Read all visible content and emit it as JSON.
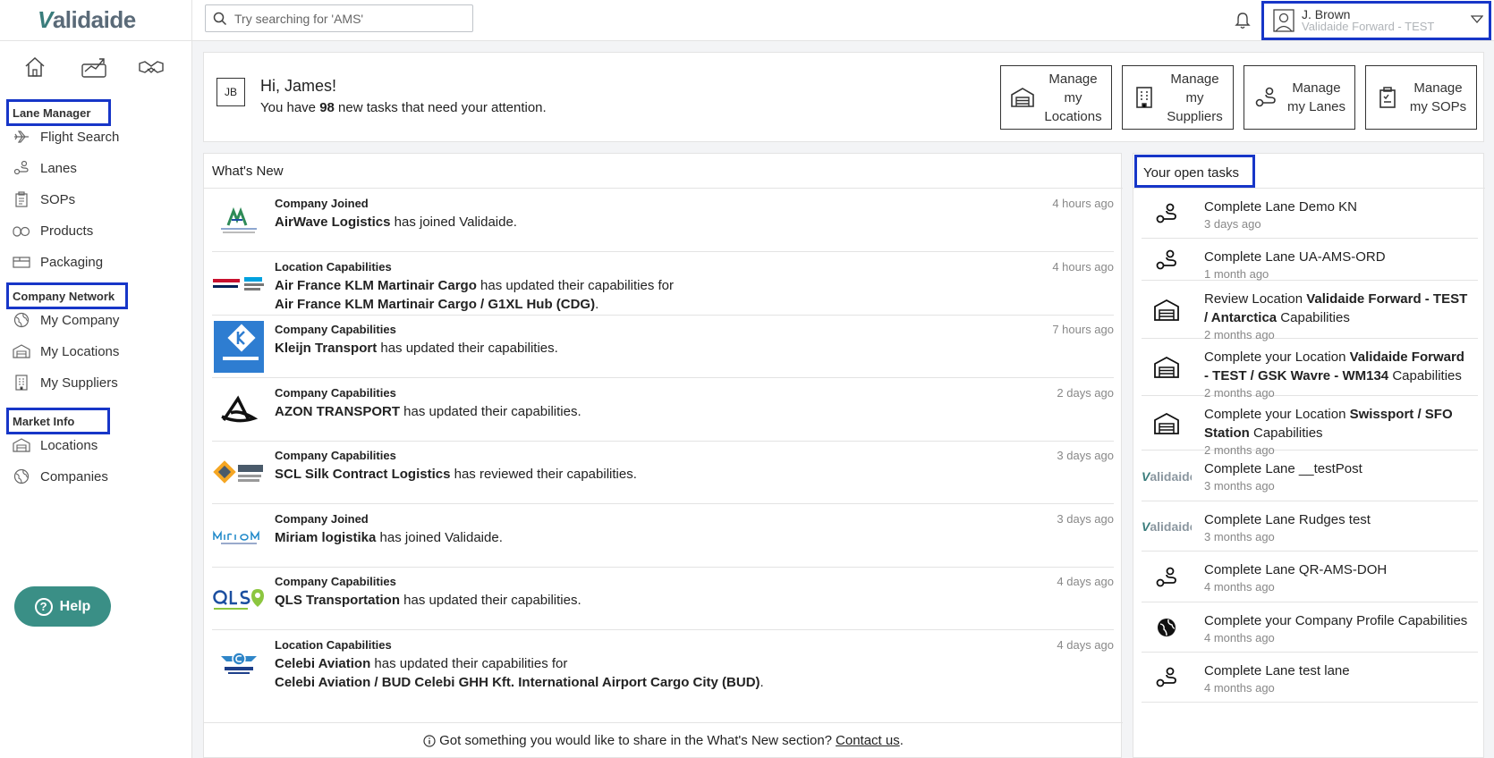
{
  "header": {
    "logo": "Validaide",
    "search_placeholder": "Try searching for 'AMS'",
    "user_name": "J. Brown",
    "user_org": "Validaide Forward - TEST"
  },
  "sidebar": {
    "sections": [
      {
        "label": "Lane Manager",
        "items": [
          "Flight Search",
          "Lanes",
          "SOPs",
          "Products",
          "Packaging"
        ]
      },
      {
        "label": "Company Network",
        "items": [
          "My Company",
          "My Locations",
          "My Suppliers"
        ]
      },
      {
        "label": "Market Info",
        "items": [
          "Locations",
          "Companies"
        ]
      }
    ],
    "help_label": "Help"
  },
  "greeting": {
    "initials": "JB",
    "hello": "Hi, James!",
    "tasks_prefix": "You have",
    "tasks_count": "98",
    "tasks_suffix": "new tasks that need your attention.",
    "buttons": [
      "Manage my Locations",
      "Manage my Suppliers",
      "Manage my Lanes",
      "Manage my SOPs"
    ]
  },
  "news": {
    "title": "What's New",
    "items": [
      {
        "kind": "Company Joined",
        "bold1": "AirWave Logistics",
        "text1": " has joined Validaide.",
        "bold2": "",
        "text2": "",
        "when": "4 hours ago",
        "logo": "airwave"
      },
      {
        "kind": "Location Capabilities",
        "bold1": "Air France KLM Martinair Cargo",
        "text1": " has updated their capabilities for",
        "bold2": "Air France KLM Martinair Cargo / G1XL Hub (CDG)",
        "text2": ".",
        "when": "4 hours ago",
        "logo": "afklm"
      },
      {
        "kind": "Company Capabilities",
        "bold1": "Kleijn Transport",
        "text1": " has updated their capabilities.",
        "bold2": "",
        "text2": "",
        "when": "7 hours ago",
        "logo": "kleijn"
      },
      {
        "kind": "Company Capabilities",
        "bold1": "AZON TRANSPORT",
        "text1": " has updated their capabilities.",
        "bold2": "",
        "text2": "",
        "when": "2 days ago",
        "logo": "azon"
      },
      {
        "kind": "Company Capabilities",
        "bold1": "SCL Silk Contract Logistics",
        "text1": " has reviewed their capabilities.",
        "bold2": "",
        "text2": "",
        "when": "3 days ago",
        "logo": "silk"
      },
      {
        "kind": "Company Joined",
        "bold1": "Miriam logistika",
        "text1": " has joined Validaide.",
        "bold2": "",
        "text2": "",
        "when": "3 days ago",
        "logo": "miriam"
      },
      {
        "kind": "Company Capabilities",
        "bold1": "QLS Transportation",
        "text1": " has updated their capabilities.",
        "bold2": "",
        "text2": "",
        "when": "4 days ago",
        "logo": "qls"
      },
      {
        "kind": "Location Capabilities",
        "bold1": "Celebi Aviation",
        "text1": " has updated their capabilities for",
        "bold2": "Celebi Aviation / BUD Celebi GHH Kft. International Airport Cargo City (BUD)",
        "text2": ".",
        "when": "4 days ago",
        "logo": "celebi"
      }
    ],
    "footer_text": "Got something you would like to share in the What's New section?",
    "footer_link": "Contact us",
    "footer_end": "."
  },
  "tasks": {
    "title": "Your open tasks",
    "items": [
      {
        "icon": "lane",
        "pre": "Complete Lane Demo KN",
        "bold": "",
        "post": "",
        "when": "3 days ago"
      },
      {
        "icon": "lane",
        "pre": "Complete Lane UA-AMS-ORD",
        "bold": "",
        "post": "",
        "when": "1 month ago"
      },
      {
        "icon": "warehouse",
        "pre": "Review Location ",
        "bold": "Validaide Forward - TEST / Antarctica",
        "post": " Capabilities",
        "when": "2 months ago"
      },
      {
        "icon": "warehouse",
        "pre": "Complete your Location ",
        "bold": "Validaide Forward - TEST / GSK Wavre - WM134",
        "post": " Capabilities",
        "when": "2 months ago"
      },
      {
        "icon": "warehouse",
        "pre": "Complete your Location ",
        "bold": "Swissport / SFO Station",
        "post": " Capabilities",
        "when": "2 months ago"
      },
      {
        "icon": "validaide",
        "pre": "Complete Lane __testPost",
        "bold": "",
        "post": "",
        "when": "3 months ago"
      },
      {
        "icon": "validaide",
        "pre": "Complete Lane Rudges test",
        "bold": "",
        "post": "",
        "when": "3 months ago"
      },
      {
        "icon": "lane",
        "pre": "Complete Lane QR-AMS-DOH",
        "bold": "",
        "post": "",
        "when": "4 months ago"
      },
      {
        "icon": "globe",
        "pre": "Complete your Company Profile Capabilities",
        "bold": "",
        "post": "",
        "when": "4 months ago"
      },
      {
        "icon": "lane",
        "pre": "Complete Lane test lane",
        "bold": "",
        "post": "",
        "when": "4 months ago"
      }
    ]
  }
}
